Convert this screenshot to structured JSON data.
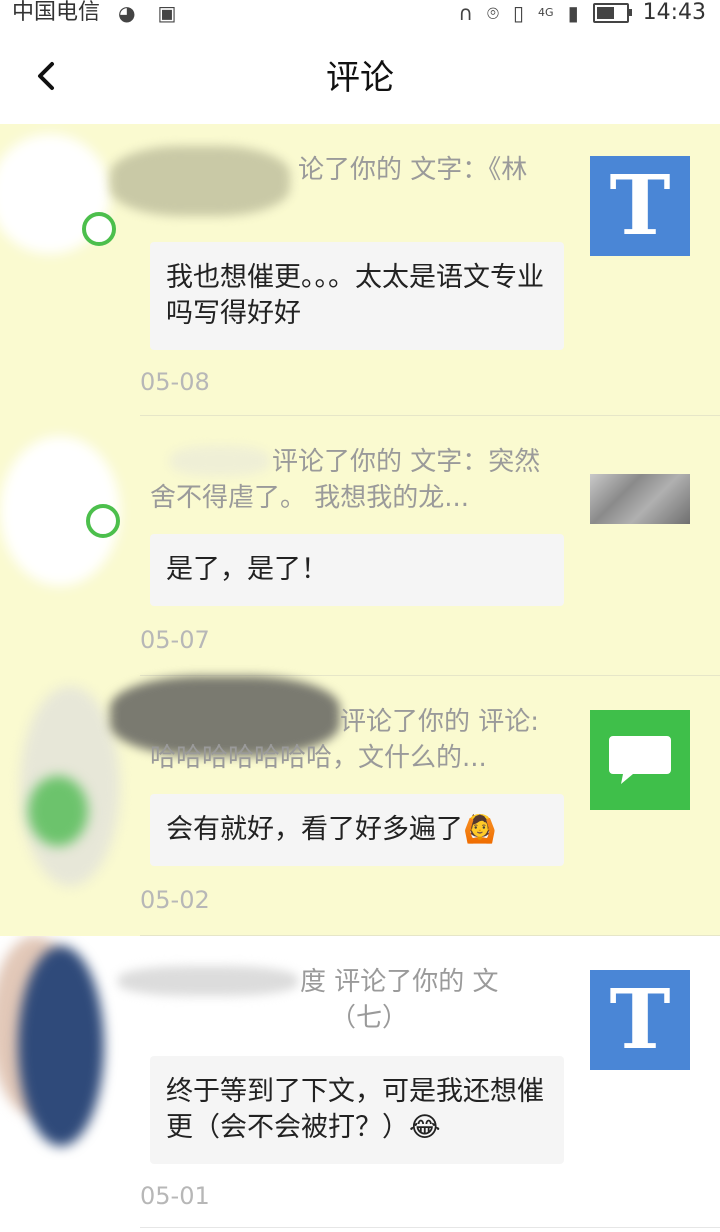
{
  "status_bar": {
    "carrier": "中国电信",
    "network": "4G",
    "time": "14:43",
    "icons": [
      "globe-icon",
      "image-icon",
      "headphones-icon",
      "location-icon",
      "vibrate-icon",
      "signal-icon",
      "battery-icon"
    ],
    "battery_level": 0.6
  },
  "navbar": {
    "title": "评论"
  },
  "items": [
    {
      "state": "unread",
      "header_line1": "论了你的 文字：《林",
      "header_line2": "",
      "comment": "我也想催更。。。太太是语文专业吗写得好好",
      "date": "05-08",
      "thumb_type": "text",
      "thumb_letter": "T"
    },
    {
      "state": "unread",
      "header_line1": "评论了你的 文字：突然",
      "header_line2": "舍不得虐了。 我想我的龙...",
      "comment": "是了，是了！",
      "date": "05-07",
      "thumb_type": "photo",
      "thumb_letter": ""
    },
    {
      "state": "unread",
      "header_line1": "评论了你的 评论:",
      "header_line2": "哈哈哈哈哈哈哈，文什么的...",
      "comment": "会有就好，看了好多遍了🙆",
      "date": "05-02",
      "thumb_type": "chat",
      "thumb_letter": ""
    },
    {
      "state": "read",
      "header_line1": "度 评论了你的 文",
      "header_line2": "（七）",
      "comment": "终于等到了下文，可是我还想催更（会不会被打？）😂",
      "date": "05-01",
      "thumb_type": "text",
      "thumb_letter": "T"
    }
  ],
  "colors": {
    "unread_bg": "#fafad0",
    "thumb_blue": "#4a86d6",
    "thumb_green": "#3fbf4a",
    "badge_green": "#4cbf4c"
  }
}
